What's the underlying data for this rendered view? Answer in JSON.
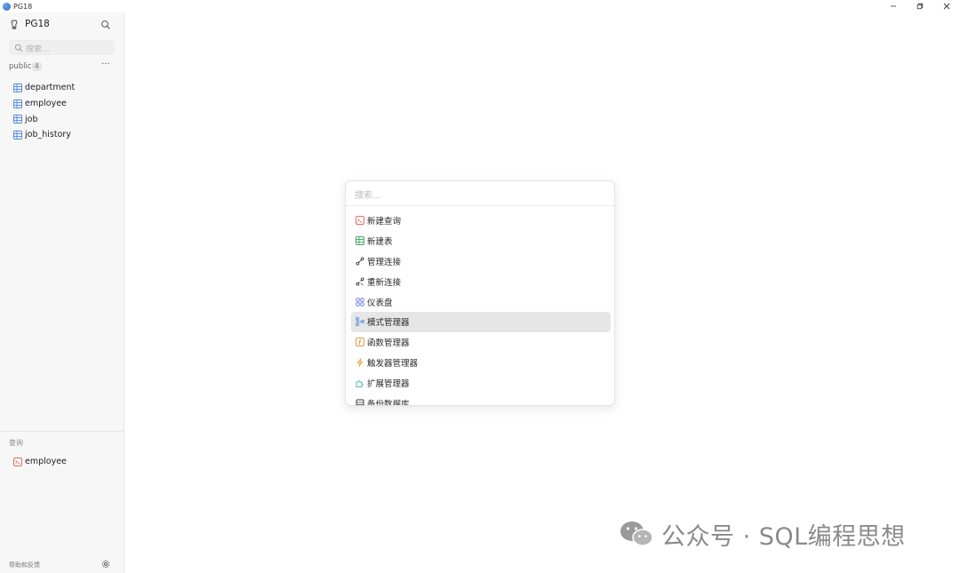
{
  "window": {
    "title": "PG18",
    "controls": [
      "minimize-icon",
      "restore-icon",
      "close-icon"
    ]
  },
  "sidebar": {
    "db_name": "PG18",
    "search_placeholder": "搜索...",
    "schema": {
      "name": "public",
      "count": "4",
      "more": "···"
    },
    "tables": [
      {
        "label": "department"
      },
      {
        "label": "employee"
      },
      {
        "label": "job"
      },
      {
        "label": "job_history"
      }
    ],
    "queries_title": "查询",
    "queries": [
      {
        "label": "employee"
      }
    ],
    "footer_help": "帮助和反馈"
  },
  "palette": {
    "search_placeholder": "搜索...",
    "items": [
      {
        "label": "新建查询",
        "icon": "new-query-icon"
      },
      {
        "label": "新建表",
        "icon": "new-table-icon"
      },
      {
        "label": "管理连接",
        "icon": "connection-icon"
      },
      {
        "label": "重新连接",
        "icon": "reconnect-icon"
      },
      {
        "label": "仪表盘",
        "icon": "dashboard-icon"
      },
      {
        "label": "模式管理器",
        "icon": "schema-manager-icon",
        "active": true
      },
      {
        "label": "函数管理器",
        "icon": "function-manager-icon"
      },
      {
        "label": "触发器管理器",
        "icon": "trigger-manager-icon"
      },
      {
        "label": "扩展管理器",
        "icon": "extension-manager-icon"
      },
      {
        "label": "备份数据库",
        "icon": "backup-icon"
      }
    ]
  },
  "watermark": {
    "text": "公众号 · SQL编程思想"
  },
  "colors": {
    "table_icon": "#3a7bd5",
    "query_icon": "#e05a4f",
    "active_row": "#e6e6e6",
    "sidebar_bg": "#f7f7f7"
  }
}
